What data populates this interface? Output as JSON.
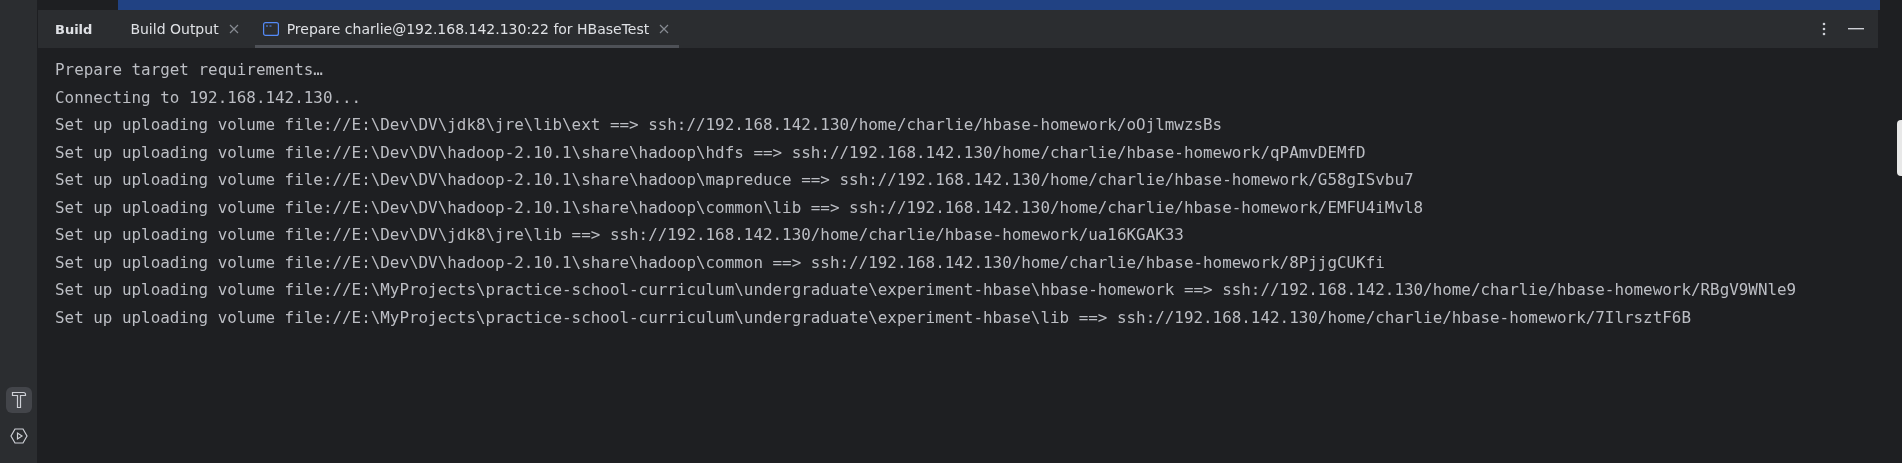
{
  "tool_strip": {
    "items": [
      {
        "kind": "hammer",
        "selected": true
      },
      {
        "kind": "run",
        "selected": false
      }
    ]
  },
  "panel": {
    "title": "Build",
    "tabs": [
      {
        "label": "Build Output",
        "selected": false,
        "icon": false
      },
      {
        "label": "Prepare charlie@192.168.142.130:22 for HBaseTest",
        "selected": true,
        "icon": true
      }
    ]
  },
  "console": {
    "lines": [
      "Prepare target requirements…",
      "Connecting to 192.168.142.130...",
      "Set up uploading volume file://E:\\Dev\\DV\\jdk8\\jre\\lib\\ext ==> ssh://192.168.142.130/home/charlie/hbase-homework/oOjlmwzsBs",
      "Set up uploading volume file://E:\\Dev\\DV\\hadoop-2.10.1\\share\\hadoop\\hdfs ==> ssh://192.168.142.130/home/charlie/hbase-homework/qPAmvDEMfD",
      "Set up uploading volume file://E:\\Dev\\DV\\hadoop-2.10.1\\share\\hadoop\\mapreduce ==> ssh://192.168.142.130/home/charlie/hbase-homework/G58gISvbu7",
      "Set up uploading volume file://E:\\Dev\\DV\\hadoop-2.10.1\\share\\hadoop\\common\\lib ==> ssh://192.168.142.130/home/charlie/hbase-homework/EMFU4iMvl8",
      "Set up uploading volume file://E:\\Dev\\DV\\jdk8\\jre\\lib ==> ssh://192.168.142.130/home/charlie/hbase-homework/ua16KGAK33",
      "Set up uploading volume file://E:\\Dev\\DV\\hadoop-2.10.1\\share\\hadoop\\common ==> ssh://192.168.142.130/home/charlie/hbase-homework/8PjjgCUKfi",
      "Set up uploading volume file://E:\\MyProjects\\practice-school-curriculum\\undergraduate\\experiment-hbase\\hbase-homework ==> ssh://192.168.142.130/home/charlie/hbase-homework/RBgV9WNle9",
      "Set up uploading volume file://E:\\MyProjects\\practice-school-curriculum\\undergraduate\\experiment-hbase\\lib ==> ssh://192.168.142.130/home/charlie/hbase-homework/7IlrsztF6B"
    ]
  }
}
